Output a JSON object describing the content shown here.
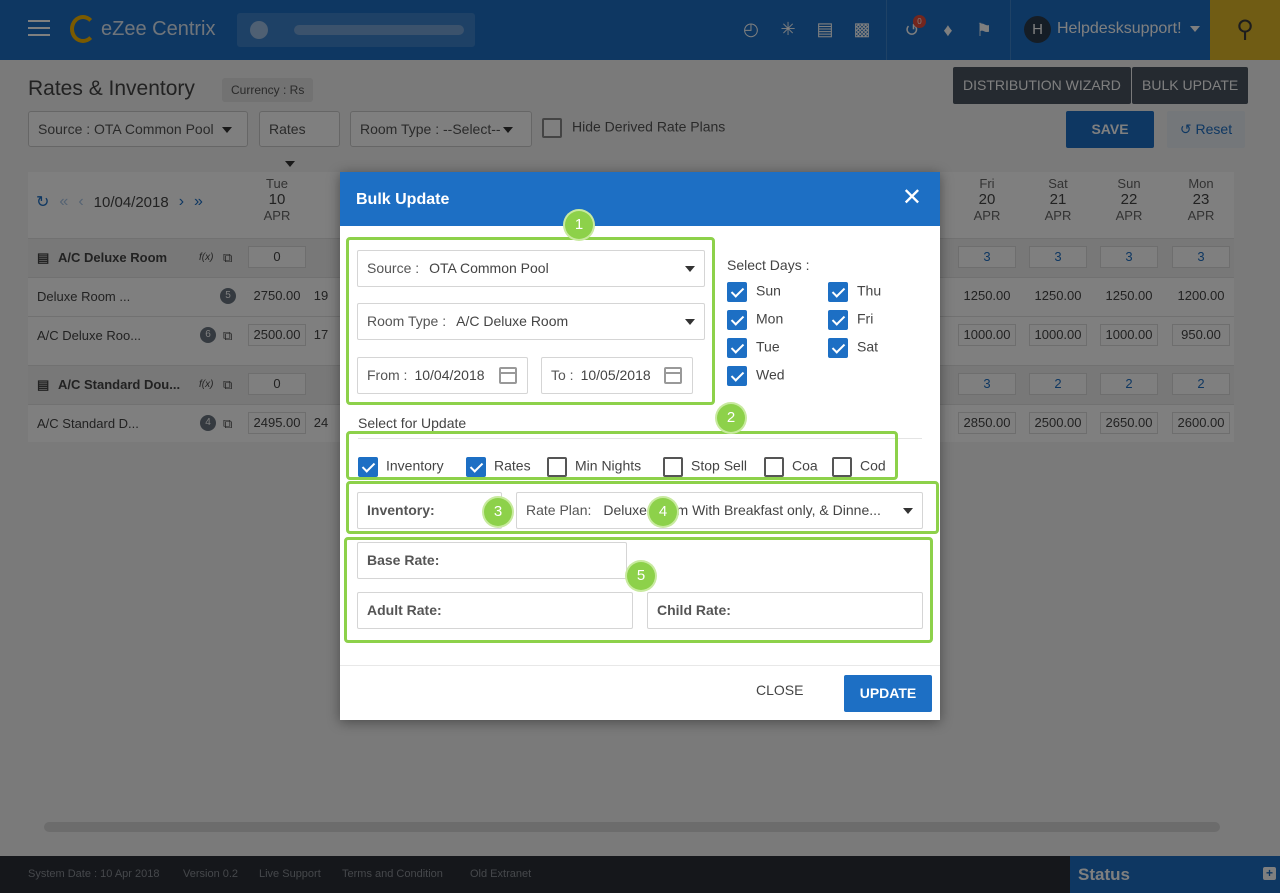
{
  "topbar": {
    "app_title": "eZee Centrix",
    "notification_count": "0",
    "user_initial": "H",
    "user_name": "Helpdesksupport!"
  },
  "page": {
    "title": "Rates & Inventory",
    "currency": "Currency : Rs",
    "distribution_wizard": "DISTRIBUTION WIZARD",
    "bulk_update": "BULK UPDATE",
    "source_filter": "Source :  OTA Common Pool",
    "rates_filter": "Rates",
    "room_type_filter": "Room Type :  --Select--",
    "hide_derived": "Hide Derived Rate Plans",
    "save": "SAVE",
    "reset": "Reset"
  },
  "grid": {
    "date": "10/04/2018",
    "left_col": {
      "dow": "Tue",
      "day": "10",
      "mon": "APR"
    },
    "right_cols": [
      {
        "dow": "Fri",
        "day": "20",
        "mon": "APR"
      },
      {
        "dow": "Sat",
        "day": "21",
        "mon": "APR"
      },
      {
        "dow": "Sun",
        "day": "22",
        "mon": "APR"
      },
      {
        "dow": "Mon",
        "day": "23",
        "mon": "APR"
      }
    ],
    "rows": [
      {
        "label": "A/C Deluxe Room",
        "fx": "f(x)",
        "left": "0",
        "left2": "",
        "right": [
          "3",
          "3",
          "3",
          "3"
        ]
      },
      {
        "label": "Deluxe Room ...",
        "badge": "5",
        "left": "2750.00",
        "left2": "19",
        "right": [
          "1250.00",
          "1250.00",
          "1250.00",
          "1200.00"
        ]
      },
      {
        "label": "A/C Deluxe Roo...",
        "badge": "6",
        "left": "2500.00",
        "left2": "17",
        "right": [
          "1000.00",
          "1000.00",
          "1000.00",
          "950.00"
        ]
      },
      {
        "label": "A/C Standard Dou...",
        "fx": "f(x)",
        "left": "0",
        "left2": "",
        "right": [
          "3",
          "2",
          "2",
          "2"
        ]
      },
      {
        "label": "A/C Standard D...",
        "badge": "4",
        "left": "2495.00",
        "left2": "24",
        "right": [
          "2850.00",
          "2500.00",
          "2650.00",
          "2600.00"
        ]
      }
    ]
  },
  "modal": {
    "title": "Bulk Update",
    "source_key": "Source :",
    "source_val": "OTA Common Pool",
    "room_type_key": "Room Type :",
    "room_type_val": "A/C Deluxe Room",
    "from_key": "From :",
    "from_val": "10/04/2018",
    "to_key": "To :",
    "to_val": "10/05/2018",
    "select_days": "Select Days :",
    "days": [
      "Sun",
      "Mon",
      "Tue",
      "Wed",
      "Thu",
      "Fri",
      "Sat"
    ],
    "select_for_update": "Select for Update",
    "update_opts": [
      "Inventory",
      "Rates",
      "Min Nights",
      "Stop Sell",
      "Coa",
      "Cod"
    ],
    "inventory_lbl": "Inventory:",
    "rate_plan_key": "Rate Plan:",
    "rate_plan_val": "Deluxe Room With Breakfast only, & Dinne...",
    "base_rate": "Base Rate:",
    "adult_rate": "Adult Rate:",
    "child_rate": "Child Rate:",
    "close": "CLOSE",
    "update": "UPDATE",
    "callouts": [
      "1",
      "2",
      "3",
      "4",
      "5"
    ]
  },
  "footer": {
    "system_date": "System Date : 10 Apr 2018",
    "version": "Version 0.2",
    "live_support": "Live Support",
    "terms": "Terms and Condition",
    "old_extranet": "Old Extranet",
    "status": "Status",
    "status_plus": "+"
  },
  "colors": {
    "primary": "#1d6fc4",
    "accent_green": "#8dd14a",
    "search_bg": "#e1b928"
  }
}
